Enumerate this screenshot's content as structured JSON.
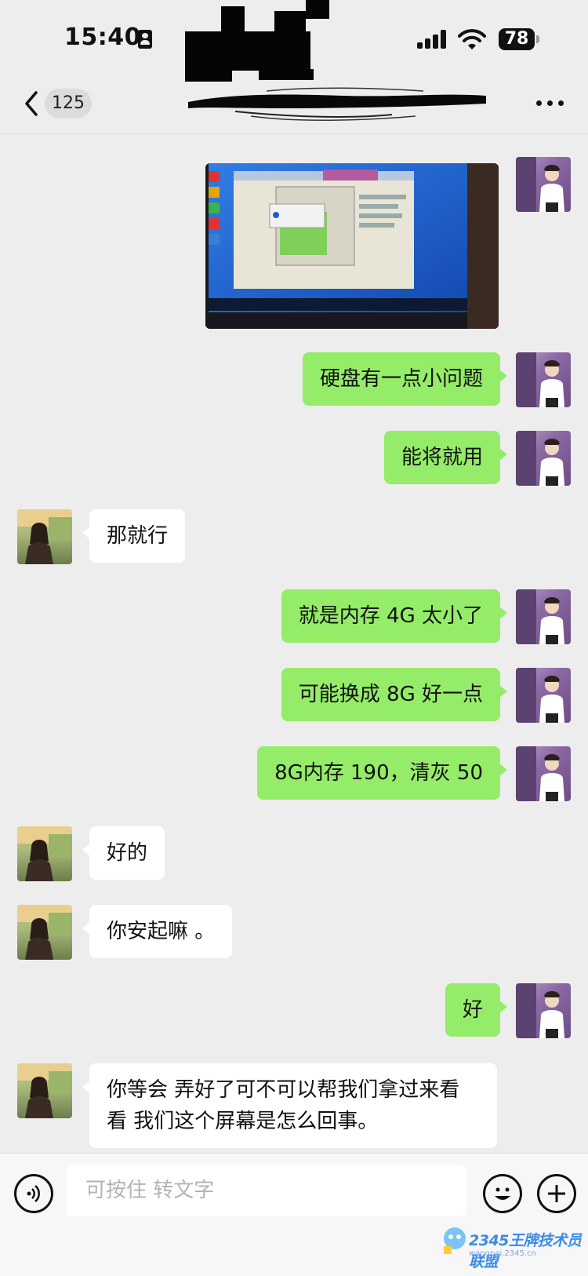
{
  "status_bar": {
    "time": "15:40",
    "battery": "78",
    "icons": [
      "id-card-icon",
      "signal-icon",
      "wifi-icon",
      "battery-icon"
    ]
  },
  "nav": {
    "back_icon": "chevron-left-icon",
    "unread_count": "125",
    "title_redacted": true,
    "more_icon": "more-dots-icon"
  },
  "messages": [
    {
      "side": "out",
      "kind": "image",
      "content": "photo of monitor showing a disk scan window"
    },
    {
      "side": "out",
      "kind": "text",
      "text": "硬盘有一点小问题"
    },
    {
      "side": "out",
      "kind": "text",
      "text": "能将就用"
    },
    {
      "side": "in",
      "kind": "text",
      "text": "那就行"
    },
    {
      "side": "out",
      "kind": "text",
      "text": "就是内存 4G 太小了"
    },
    {
      "side": "out",
      "kind": "text",
      "text": "可能换成 8G 好一点"
    },
    {
      "side": "out",
      "kind": "text",
      "text": "8G内存 190，清灰 50"
    },
    {
      "side": "in",
      "kind": "text",
      "text": "好的"
    },
    {
      "side": "in",
      "kind": "text",
      "text": "你安起嘛 。"
    },
    {
      "side": "out",
      "kind": "text",
      "text": "好"
    },
    {
      "side": "in",
      "kind": "text",
      "text": "你等会 弄好了可不可以帮我们拿过来看看 我们这个屏幕是怎么回事。"
    }
  ],
  "input_bar": {
    "placeholder": "可按住 转文字",
    "voice_icon": "voice-icon",
    "emoji_icon": "emoji-icon",
    "plus_icon": "plus-icon"
  },
  "watermark": {
    "text": "2345王牌技术员联盟",
    "sub": "wangpai.2345.cn"
  },
  "colors": {
    "background": "#ededed",
    "outgoing_bubble": "#95ec69",
    "incoming_bubble": "#ffffff"
  }
}
